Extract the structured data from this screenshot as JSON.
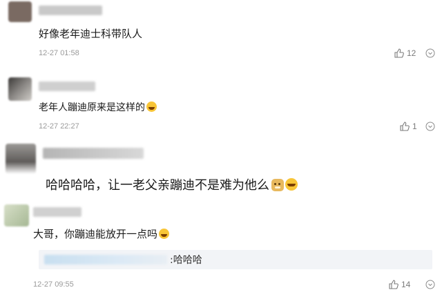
{
  "comments": [
    {
      "text": "好像老年迪士科带队人",
      "time": "12-27 01:58",
      "likes": "12"
    },
    {
      "text": "老年人蹦迪原来是这样的",
      "time": "12-27 22:27",
      "likes": "1"
    },
    {
      "text": "哈哈哈哈，让一老父亲蹦迪不是难为他么",
      "time": "",
      "likes": ""
    },
    {
      "text": "大哥，你蹦迪能放开一点吗",
      "time": "12-27 09:55",
      "likes": "14",
      "reply": {
        "suffix": ":哈哈哈"
      }
    }
  ],
  "colors": {
    "avatar1": "#7a6a62",
    "avatar2": "#5d5a57",
    "avatar3": "#6b6866",
    "avatar4": "#b7c4a8"
  },
  "icons": [
    "thumbs-up-icon",
    "chevron-down-icon",
    "laugh-emoji-icon",
    "doge-emoji-icon"
  ]
}
